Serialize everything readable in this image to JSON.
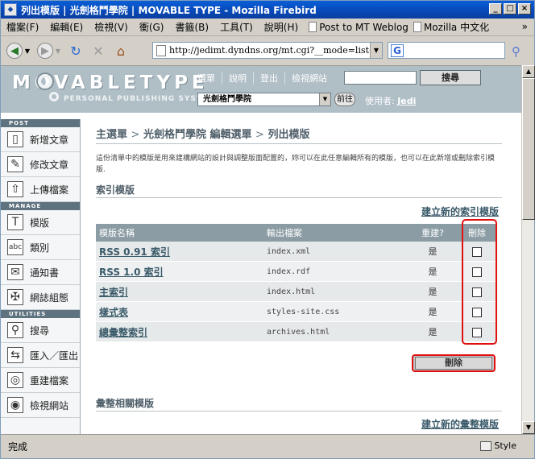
{
  "window": {
    "title": "列出模版 | 光劍格鬥學院 | MOVABLE TYPE - Mozilla Firebird",
    "minimize": "_",
    "maximize": "□",
    "close": "×"
  },
  "menubar": {
    "items": [
      "檔案(F)",
      "編輯(E)",
      "檢視(V)",
      "衝(G)",
      "書籤(B)",
      "工具(T)",
      "說明(H)"
    ],
    "bookmarks": [
      "Post to MT Weblog",
      "Mozilla 中文化"
    ],
    "more": "»"
  },
  "navbar": {
    "url": "http://jedimt.dyndns.org/mt.cgi?__mode=list&_type=",
    "search_engine": "G",
    "url_dropdown": "▼"
  },
  "mt_header": {
    "logo": "MOVABLETYPE",
    "tagline": "PERSONAL PUBLISHING SYSTEM",
    "nav": [
      "選單",
      "說明",
      "登出",
      "檢視網站"
    ],
    "search_button": "搜尋",
    "blog_select": "光劍格鬥學院",
    "go_button": "前往",
    "user_label": "使用者:",
    "user_name": "Jedi"
  },
  "sidebar": {
    "post_header": "POST",
    "post_items": [
      {
        "label": "新增文章",
        "icon": "new-entry-icon"
      },
      {
        "label": "修改文章",
        "icon": "edit-entries-icon"
      },
      {
        "label": "上傳檔案",
        "icon": "upload-icon"
      }
    ],
    "manage_header": "MANAGE",
    "manage_items": [
      {
        "label": "模版",
        "icon": "templates-icon"
      },
      {
        "label": "類別",
        "icon": "categories-icon"
      },
      {
        "label": "通知書",
        "icon": "notifications-icon"
      },
      {
        "label": "網誌組態",
        "icon": "configuration-icon"
      }
    ],
    "utilities_header": "UTILITIES",
    "utilities_items": [
      {
        "label": "搜尋",
        "icon": "search-icon"
      },
      {
        "label": "匯入／匯出",
        "icon": "import-export-icon"
      },
      {
        "label": "重建檔案",
        "icon": "rebuild-icon"
      },
      {
        "label": "檢視網站",
        "icon": "view-site-icon"
      }
    ]
  },
  "main": {
    "breadcrumb": [
      "主選單",
      "光劍格鬥學院 編輯選單",
      "列出模版"
    ],
    "breadcrumb_sep": ">",
    "description": "這份清單中的模版是用來建構網站的設計與調整版面配置的，妳可以在此任意編輯所有的模版，也可以在此新增或刪除索引模版.",
    "index_section_title": "索引模版",
    "create_index_link": "建立新的索引模版",
    "table_headers": [
      "模版名稱",
      "輸出檔案",
      "重建?",
      "刪除"
    ],
    "rows": [
      {
        "name": "RSS 0.91 索引",
        "output": "index.xml",
        "rebuild": "是"
      },
      {
        "name": "RSS 1.0 索引",
        "output": "index.rdf",
        "rebuild": "是"
      },
      {
        "name": "主索引",
        "output": "index.html",
        "rebuild": "是"
      },
      {
        "name": "樣式表",
        "output": "styles-site.css",
        "rebuild": "是"
      },
      {
        "name": "總彙整索引",
        "output": "archives.html",
        "rebuild": "是"
      }
    ],
    "delete_button": "刪除",
    "archive_section_title": "彙整相關模版",
    "create_archive_link": "建立新的彙整模版"
  },
  "statusbar": {
    "status": "完成",
    "style_label": "Style"
  }
}
